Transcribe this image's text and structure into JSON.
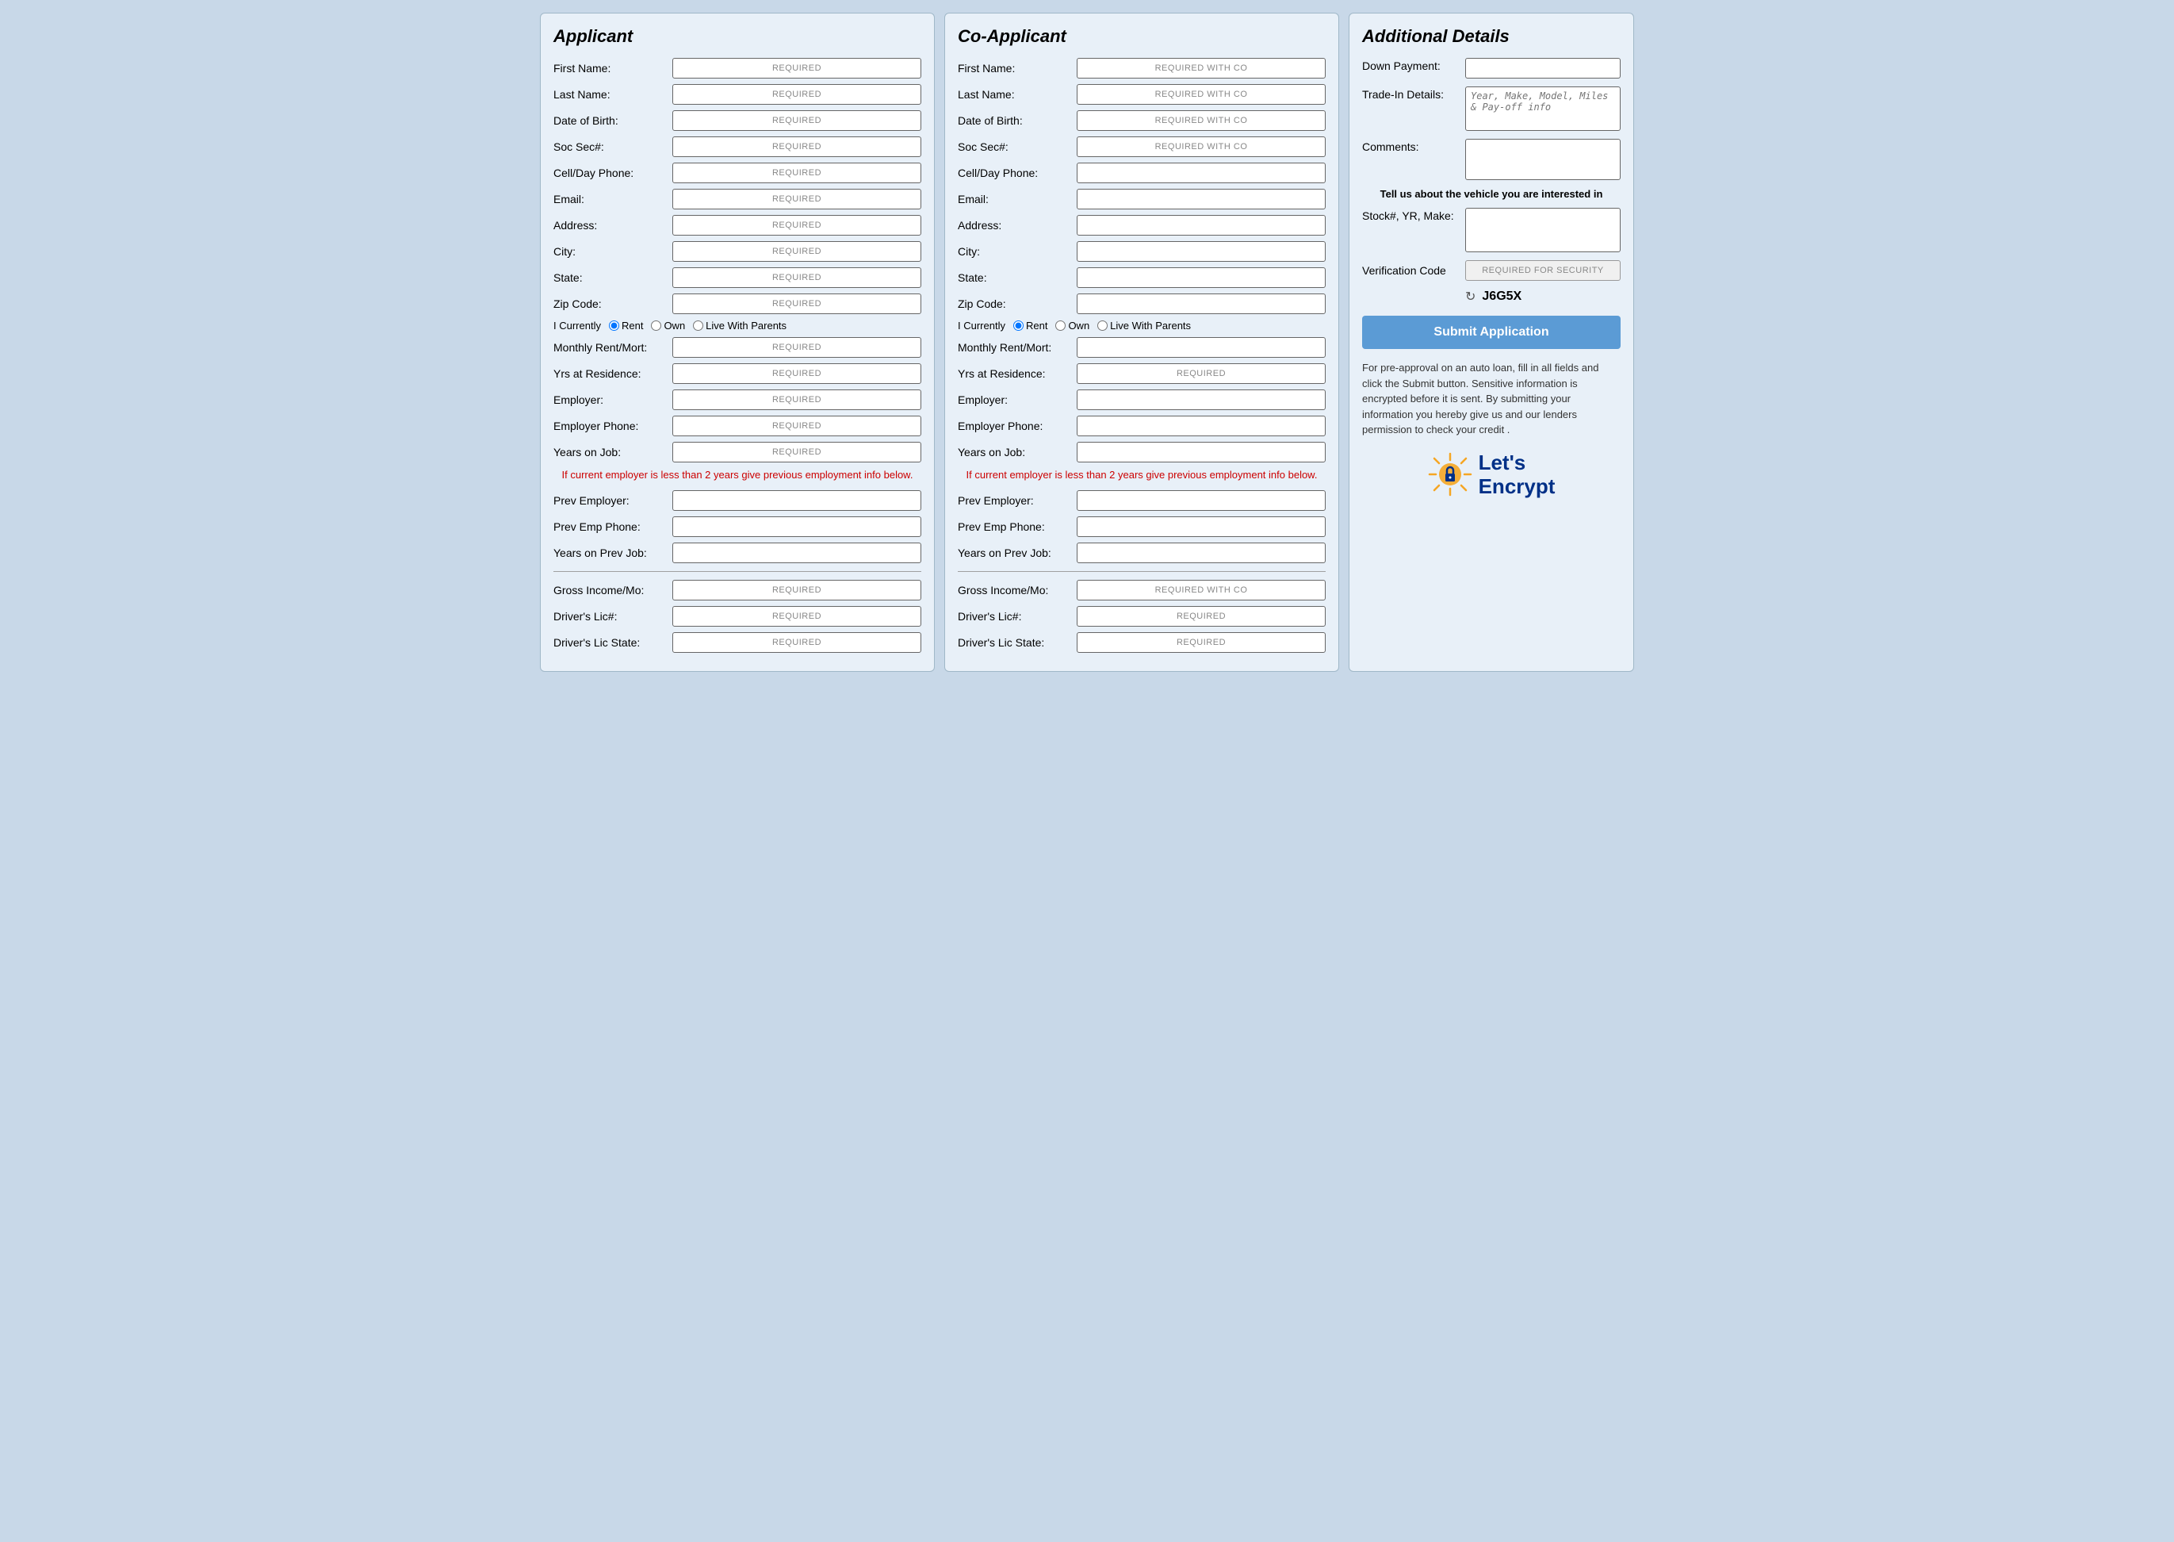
{
  "applicant": {
    "title": "Applicant",
    "fields": [
      {
        "label": "First Name:",
        "placeholder": "REQUIRED",
        "name": "app-first-name"
      },
      {
        "label": "Last Name:",
        "placeholder": "REQUIRED",
        "name": "app-last-name"
      },
      {
        "label": "Date of Birth:",
        "placeholder": "REQUIRED",
        "name": "app-dob"
      },
      {
        "label": "Soc Sec#:",
        "placeholder": "REQUIRED",
        "name": "app-ssn"
      },
      {
        "label": "Cell/Day Phone:",
        "placeholder": "REQUIRED",
        "name": "app-phone"
      },
      {
        "label": "Email:",
        "placeholder": "REQUIRED",
        "name": "app-email"
      },
      {
        "label": "Address:",
        "placeholder": "REQUIRED",
        "name": "app-address"
      },
      {
        "label": "City:",
        "placeholder": "REQUIRED",
        "name": "app-city"
      },
      {
        "label": "State:",
        "placeholder": "REQUIRED",
        "name": "app-state"
      },
      {
        "label": "Zip Code:",
        "placeholder": "REQUIRED",
        "name": "app-zip"
      }
    ],
    "radio_prefix": "I Currently",
    "radio_options": [
      "Rent",
      "Own",
      "Live With Parents"
    ],
    "radio_selected": "Rent",
    "employment_fields": [
      {
        "label": "Monthly Rent/Mort:",
        "placeholder": "REQUIRED",
        "name": "app-monthly-rent"
      },
      {
        "label": "Yrs at Residence:",
        "placeholder": "REQUIRED",
        "name": "app-yrs-residence"
      },
      {
        "label": "Employer:",
        "placeholder": "REQUIRED",
        "name": "app-employer"
      },
      {
        "label": "Employer Phone:",
        "placeholder": "REQUIRED",
        "name": "app-employer-phone"
      },
      {
        "label": "Years on Job:",
        "placeholder": "REQUIRED",
        "name": "app-years-job"
      }
    ],
    "employer_note": "If current employer is less than 2 years give previous employment info below.",
    "prev_fields": [
      {
        "label": "Prev Employer:",
        "placeholder": "",
        "name": "app-prev-employer"
      },
      {
        "label": "Prev Emp Phone:",
        "placeholder": "",
        "name": "app-prev-emp-phone"
      },
      {
        "label": "Years on Prev Job:",
        "placeholder": "",
        "name": "app-prev-years"
      }
    ],
    "financial_fields": [
      {
        "label": "Gross Income/Mo:",
        "placeholder": "REQUIRED",
        "name": "app-gross-income"
      },
      {
        "label": "Driver's Lic#:",
        "placeholder": "REQUIRED",
        "name": "app-dl-number"
      },
      {
        "label": "Driver's Lic State:",
        "placeholder": "REQUIRED",
        "name": "app-dl-state"
      }
    ]
  },
  "coapplicant": {
    "title": "Co-Applicant",
    "fields": [
      {
        "label": "First Name:",
        "placeholder": "REQUIRED WITH CO",
        "name": "co-first-name"
      },
      {
        "label": "Last Name:",
        "placeholder": "REQUIRED WITH CO",
        "name": "co-last-name"
      },
      {
        "label": "Date of Birth:",
        "placeholder": "REQUIRED WITH CO",
        "name": "co-dob"
      },
      {
        "label": "Soc Sec#:",
        "placeholder": "REQUIRED WITH CO",
        "name": "co-ssn"
      },
      {
        "label": "Cell/Day Phone:",
        "placeholder": "",
        "name": "co-phone"
      },
      {
        "label": "Email:",
        "placeholder": "",
        "name": "co-email"
      },
      {
        "label": "Address:",
        "placeholder": "",
        "name": "co-address"
      },
      {
        "label": "City:",
        "placeholder": "",
        "name": "co-city"
      },
      {
        "label": "State:",
        "placeholder": "",
        "name": "co-state"
      },
      {
        "label": "Zip Code:",
        "placeholder": "",
        "name": "co-zip"
      }
    ],
    "radio_prefix": "I Currently",
    "radio_options": [
      "Rent",
      "Own",
      "Live With Parents"
    ],
    "radio_selected": "Rent",
    "employment_fields": [
      {
        "label": "Monthly Rent/Mort:",
        "placeholder": "",
        "name": "co-monthly-rent"
      },
      {
        "label": "Yrs at Residence:",
        "placeholder": "REQUIRED",
        "name": "co-yrs-residence"
      },
      {
        "label": "Employer:",
        "placeholder": "",
        "name": "co-employer"
      },
      {
        "label": "Employer Phone:",
        "placeholder": "",
        "name": "co-employer-phone"
      },
      {
        "label": "Years on Job:",
        "placeholder": "",
        "name": "co-years-job"
      }
    ],
    "employer_note": "If current employer is less than 2 years give previous employment info below.",
    "prev_fields": [
      {
        "label": "Prev Employer:",
        "placeholder": "",
        "name": "co-prev-employer"
      },
      {
        "label": "Prev Emp Phone:",
        "placeholder": "",
        "name": "co-prev-emp-phone"
      },
      {
        "label": "Years on Prev Job:",
        "placeholder": "",
        "name": "co-prev-years"
      }
    ],
    "financial_fields": [
      {
        "label": "Gross Income/Mo:",
        "placeholder": "REQUIRED WITH CO",
        "name": "co-gross-income"
      },
      {
        "label": "Driver's Lic#:",
        "placeholder": "REQUIRED",
        "name": "co-dl-number"
      },
      {
        "label": "Driver's Lic State:",
        "placeholder": "REQUIRED",
        "name": "co-dl-state"
      }
    ]
  },
  "additional": {
    "title": "Additional Details",
    "down_payment_label": "Down Payment:",
    "trade_in_label": "Trade-In Details:",
    "trade_in_placeholder": "Year, Make, Model, Miles & Pay-off info",
    "comments_label": "Comments:",
    "vehicle_heading": "Tell us about the vehicle you are interested in",
    "stock_label": "Stock#, YR, Make:",
    "verification_label": "Verification Code",
    "verification_placeholder": "REQUIRED FOR SECURITY",
    "captcha_code": "J6G5X",
    "submit_label": "Submit Application",
    "disclaimer": "For pre-approval on an auto loan, fill in all fields and click the Submit button. Sensitive information is encrypted before it is sent. By submitting your information you hereby give us and our lenders permission to check your credit .",
    "lets_encrypt_line1": "Let's",
    "lets_encrypt_line2": "Encrypt"
  }
}
